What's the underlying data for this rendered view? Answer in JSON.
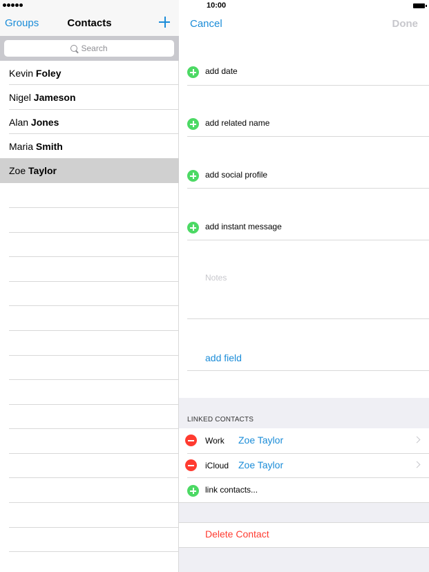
{
  "status": {
    "time": "10:00"
  },
  "left_nav": {
    "groups": "Groups",
    "title": "Contacts"
  },
  "search": {
    "placeholder": "Search"
  },
  "contacts": [
    {
      "first": "Kevin",
      "last": "Foley"
    },
    {
      "first": "Nigel",
      "last": "Jameson"
    },
    {
      "first": "Alan",
      "last": "Jones"
    },
    {
      "first": "Maria",
      "last": "Smith"
    },
    {
      "first": "Zoe",
      "last": "Taylor",
      "selected": true
    }
  ],
  "right_nav": {
    "cancel": "Cancel",
    "done": "Done"
  },
  "fields": [
    {
      "label": "add date"
    },
    {
      "label": "add related name"
    },
    {
      "label": "add social profile"
    },
    {
      "label": "add instant message"
    }
  ],
  "notes_placeholder": "Notes",
  "add_field": "add field",
  "linked": {
    "header": "LINKED CONTACTS",
    "items": [
      {
        "type": "Work",
        "name": "Zoe Taylor"
      },
      {
        "type": "iCloud",
        "name": "Zoe Taylor"
      }
    ],
    "link_label": "link contacts..."
  },
  "delete_label": "Delete Contact",
  "colors": {
    "accent": "#1a8cd8",
    "add": "#4cd964",
    "remove": "#ff3b30"
  }
}
